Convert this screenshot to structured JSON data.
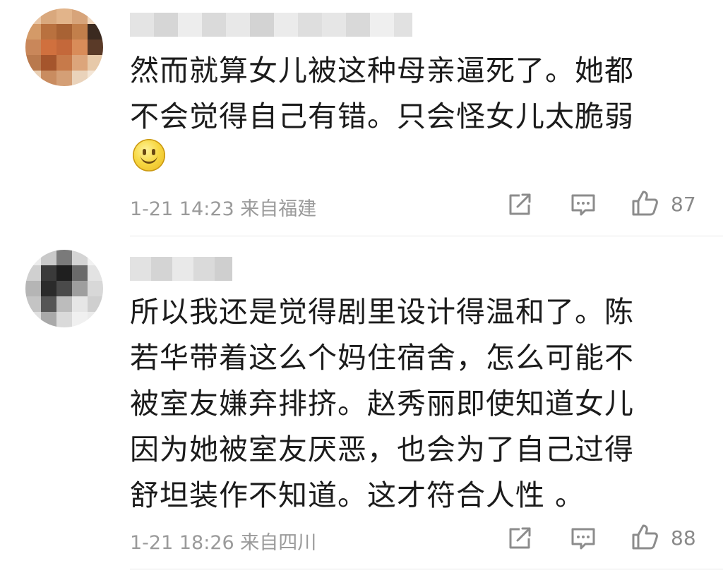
{
  "comments": [
    {
      "text_lines": [
        "然而就算女儿被这种母亲逼死了。她都",
        "不会觉得自己有错。只会怪女儿太脆弱"
      ],
      "emoji": "smile-emoji",
      "time": "1-21 14:23",
      "location": "来自福建",
      "like_count": "87",
      "icons": [
        "share-icon",
        "comment-icon",
        "like-icon"
      ]
    },
    {
      "text_lines": [
        "所以我还是觉得剧里设计得温和了。陈",
        "若华带着这么个妈住宿舍，怎么可能不",
        "被室友嫌弃排挤。赵秀丽即使知道女儿",
        "因为她被室友厌恶，也会为了自己过得",
        "舒坦装作不知道。这才符合人性 。"
      ],
      "time": "1-21 18:26",
      "location": "来自四川",
      "like_count": "88",
      "icons": [
        "share-icon",
        "comment-icon",
        "like-icon"
      ]
    }
  ],
  "colors": {
    "text": "#1b1b1b",
    "meta": "#9a9a9a",
    "icon": "#8c8c8c",
    "divider": "#e8e8e8"
  }
}
